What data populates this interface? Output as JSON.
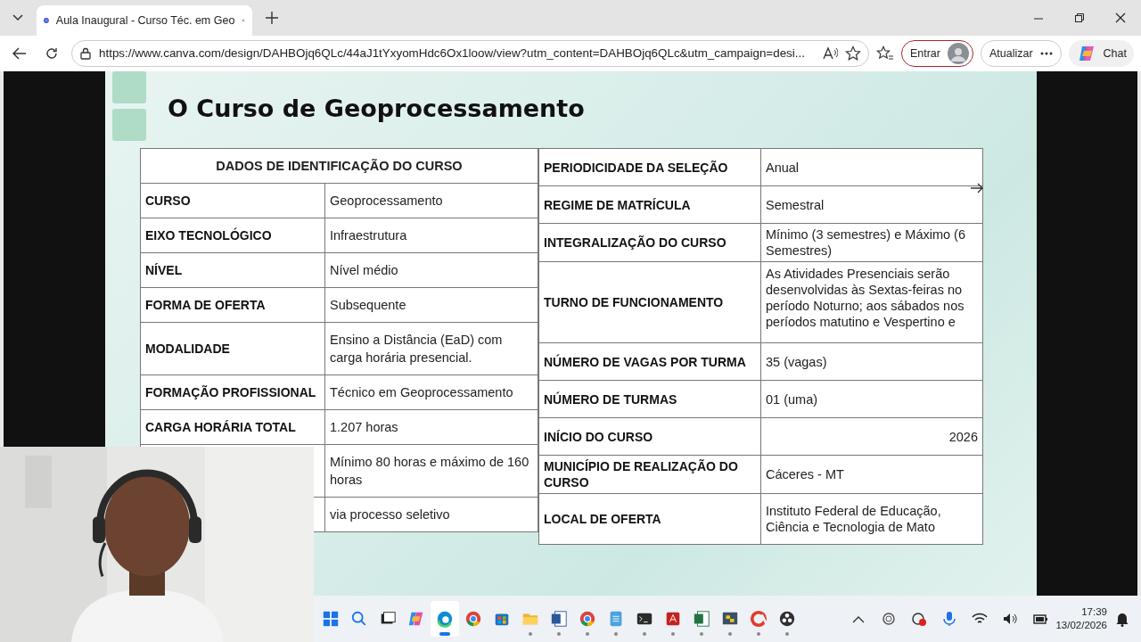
{
  "browser": {
    "tabs": [
      {
        "title": "Aula Inaugural - Curso Téc. em Geo",
        "selected": true
      }
    ],
    "url": "https://www.canva.com/design/DAHBOjq6QLc/44aJ1tYxyomHdc6Ox1loow/view?utm_content=DAHBOjq6QLc&utm_campaign=desi...",
    "signin_button": "Entrar",
    "update_button": "Atualizar",
    "chat_button": "Chat"
  },
  "slide": {
    "title": "O Curso de Geoprocessamento",
    "left_table": {
      "heading": "DADOS DE IDENTIFICAÇÃO DO CURSO",
      "rows": [
        {
          "label": "CURSO",
          "value": "Geoprocessamento"
        },
        {
          "label": "EIXO TECNOLÓGICO",
          "value": "Infraestrutura"
        },
        {
          "label": "NÍVEL",
          "value": "Nível médio"
        },
        {
          "label": "FORMA DE OFERTA",
          "value": "Subsequente"
        },
        {
          "label": "MODALIDADE",
          "value": "Ensino a Distância (EaD) com carga horária presencial."
        },
        {
          "label": "FORMAÇÃO PROFISSIONAL",
          "value": "Técnico em Geoprocessamento"
        },
        {
          "label": "CARGA HORÁRIA TOTAL",
          "value": "1.207 horas"
        },
        {
          "value": "Mínimo 80 horas e máximo de 160 horas"
        },
        {
          "value": "via processo seletivo"
        }
      ]
    },
    "right_table": {
      "rows": [
        {
          "label": "PERIODICIDADE DA SELEÇÃO",
          "value": "Anual"
        },
        {
          "label": "REGIME DE MATRÍCULA",
          "value": "Semestral"
        },
        {
          "label": "INTEGRALIZAÇÃO DO CURSO",
          "value": "Mínimo (3 semestres) e Máximo (6 Semestres)"
        },
        {
          "label": "TURNO DE FUNCIONAMENTO",
          "value": "As Atividades Presenciais serão desenvolvidas às Sextas-feiras no período Noturno; aos sábados nos períodos matutino e Vespertino e"
        },
        {
          "label": "NÚMERO DE VAGAS POR TURMA",
          "value": "35 (vagas)"
        },
        {
          "label": "NÚMERO DE TURMAS",
          "value": "01 (uma)"
        },
        {
          "label": "INÍCIO DO CURSO",
          "value": "2026",
          "right_aligned": true
        },
        {
          "label": "MUNICÍPIO DE REALIZAÇÃO DO CURSO",
          "value": "Cáceres - MT"
        },
        {
          "label": "LOCAL DE OFERTA",
          "value": "Instituto Federal de Educação, Ciência e Tecnologia de Mato"
        }
      ]
    }
  },
  "taskbar": {
    "apps": [
      {
        "kind": "start",
        "selected": false,
        "running": false
      },
      {
        "kind": "search",
        "selected": false,
        "running": false
      },
      {
        "kind": "taskview",
        "selected": false,
        "running": false
      },
      {
        "kind": "copilot",
        "selected": false,
        "running": false
      },
      {
        "kind": "edge",
        "selected": true,
        "running": true
      },
      {
        "kind": "chrome",
        "selected": false,
        "running": false
      },
      {
        "kind": "store",
        "selected": false,
        "running": false
      },
      {
        "kind": "folder",
        "selected": false,
        "running": true
      },
      {
        "kind": "word",
        "selected": false,
        "running": true
      },
      {
        "kind": "chrome",
        "selected": false,
        "running": true
      },
      {
        "kind": "notepad",
        "selected": false,
        "running": true
      },
      {
        "kind": "terminal",
        "selected": false,
        "running": true
      },
      {
        "kind": "pdf",
        "selected": false,
        "running": true
      },
      {
        "kind": "excel",
        "selected": false,
        "running": true
      },
      {
        "kind": "python",
        "selected": false,
        "running": true
      },
      {
        "kind": "cleaner",
        "selected": false,
        "running": true
      },
      {
        "kind": "recorder",
        "selected": false,
        "running": true
      }
    ],
    "time": "17:39",
    "date": "13/02/2026"
  }
}
